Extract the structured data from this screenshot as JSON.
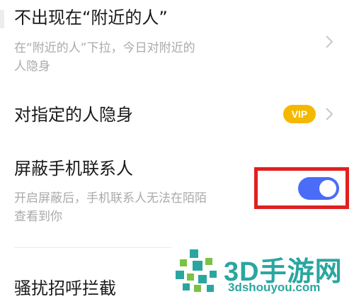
{
  "settings": {
    "items": [
      {
        "title": "不出现在“附近的人”",
        "subtitle_line1": "在“附近的人”下拉，今日对附近的",
        "subtitle_line2": "人隐身"
      },
      {
        "title": "对指定的人隐身",
        "badge": "VIP"
      },
      {
        "title": "屏蔽手机联系人",
        "subtitle_line1": "开启屏蔽后，手机联系人无法在陌陌",
        "subtitle_line2": "查看到你",
        "toggle_on": true
      },
      {
        "title": "骚扰招呼拦截"
      }
    ]
  },
  "watermark": {
    "brand": "3D手游网",
    "url": "3dshouyou.com"
  },
  "colors": {
    "toggle_on": "#4a6cf7",
    "vip_badge": "#f5b800",
    "highlight_box": "#e02020",
    "watermark": "#2aa6a0"
  }
}
